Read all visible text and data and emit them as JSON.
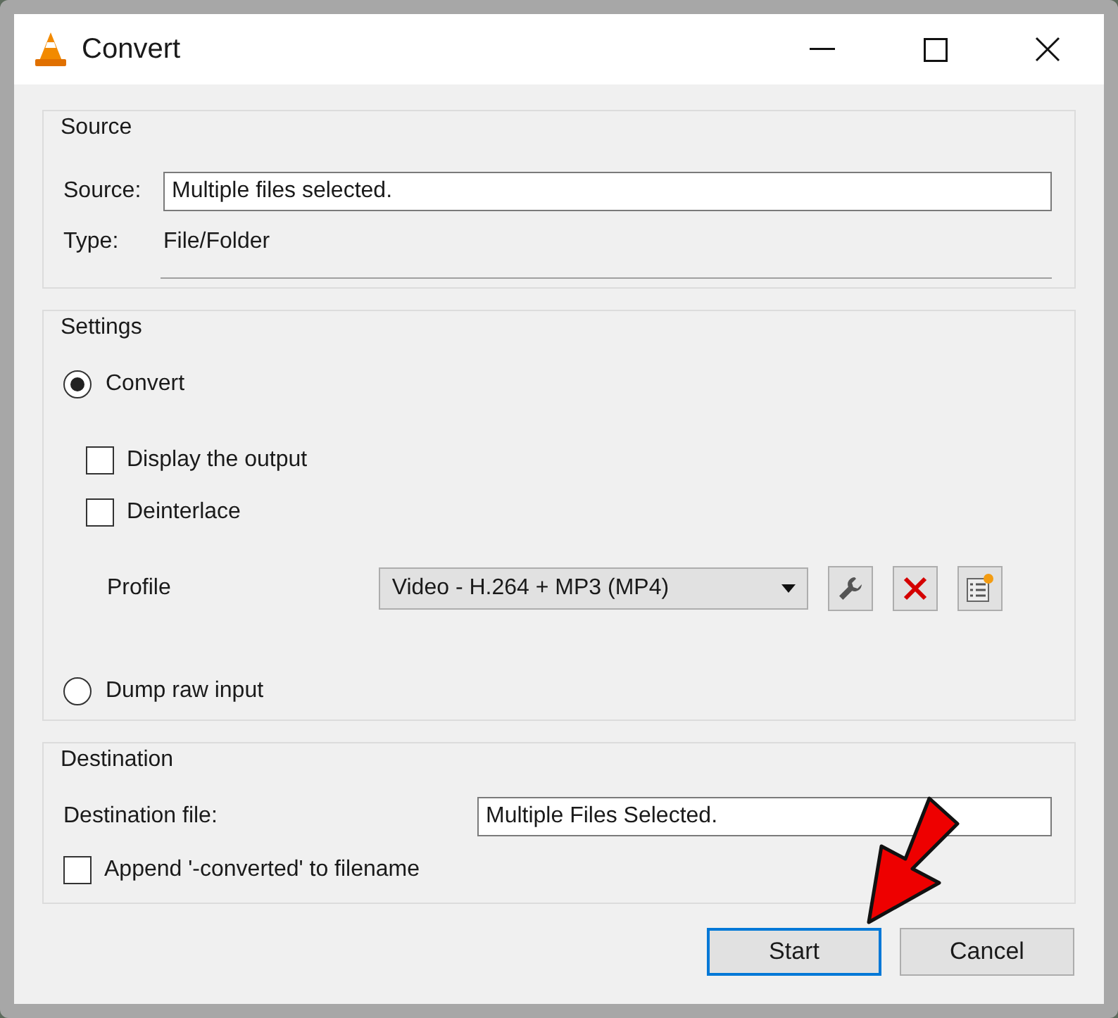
{
  "window": {
    "title": "Convert"
  },
  "source": {
    "title": "Source",
    "source_label": "Source:",
    "source_value": "Multiple files selected.",
    "type_label": "Type:",
    "type_value": "File/Folder"
  },
  "settings": {
    "title": "Settings",
    "convert": {
      "label": "Convert",
      "selected": true
    },
    "checkboxes": [
      {
        "label": "Display the output",
        "checked": false
      },
      {
        "label": "Deinterlace",
        "checked": false
      }
    ],
    "profile": {
      "label": "Profile",
      "value": "Video - H.264 + MP3 (MP4)"
    },
    "dump": {
      "label": "Dump raw input",
      "selected": false
    }
  },
  "destination": {
    "title": "Destination",
    "file_label": "Destination file:",
    "file_value": "Multiple Files Selected.",
    "append": {
      "label": "Append '-converted' to filename",
      "checked": false
    }
  },
  "buttons": [
    {
      "label": "Start",
      "default": true
    },
    {
      "label": "Cancel",
      "default": false
    }
  ]
}
